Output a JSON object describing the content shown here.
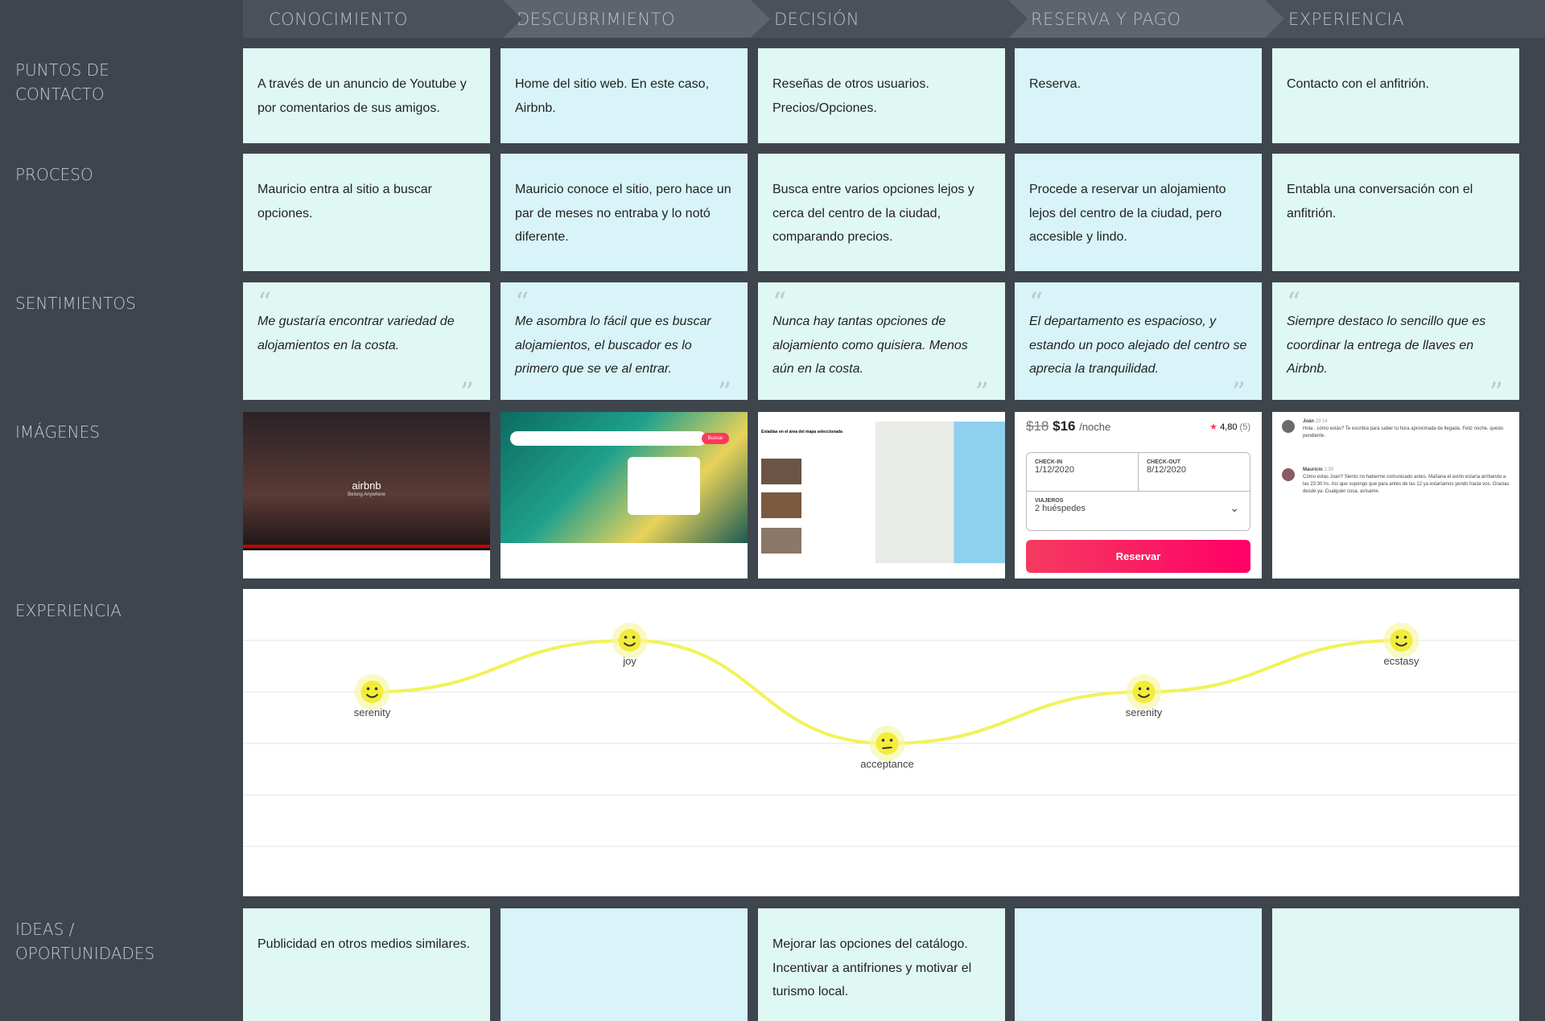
{
  "stages": [
    "CONOCIMIENTO",
    "DESCUBRIMIENTO",
    "DECISIÓN",
    "RESERVA Y PAGO",
    "EXPERIENCIA"
  ],
  "row_labels": {
    "touchpoints": "PUNTOS DE CONTACTO",
    "process": "PROCESO",
    "feelings": "SENTIMIENTOS",
    "images": "IMÁGENES",
    "experience": "EXPERIENCIA",
    "ideas": "IDEAS / OPORTUNIDADES"
  },
  "touchpoints": [
    "A través de un anuncio de Youtube y por comentarios de sus amigos.",
    "Home del sitio web. En este caso, Airbnb.",
    "Reseñas de otros usuarios. Precios/Opciones.",
    "Reserva.",
    "Contacto con el anfitrión."
  ],
  "process": [
    "Mauricio entra al sitio a buscar opciones.",
    "Mauricio conoce el sitio, pero hace un par de meses no entraba y lo notó diferente.",
    "Busca entre varios opciones lejos y cerca del centro de la ciudad, comparando precios.",
    "Procede a reservar un alojamiento lejos del centro de la ciudad, pero accesible y lindo.",
    "Entabla una conversación con el anfitrión."
  ],
  "feelings": [
    "Me gustaría encontrar variedad de alojamientos en la costa.",
    "Me asombra lo fácil que es buscar alojamientos, el buscador es lo primero que se ve al entrar.",
    "Nunca hay tantas opciones de alojamiento como quisiera. Menos aún en la costa.",
    "El departamento es espacioso, y estando un poco alejado del centro se aprecia la tranquilidad.",
    "Siempre destaco lo sencillo que es coordinar la entrega de llaves en Airbnb."
  ],
  "images": {
    "youtube": {
      "logo": "airbnb",
      "tagline": "Belong Anywhere"
    },
    "home": {
      "button": "Buscar"
    },
    "listing": {
      "title": "Estadías en el área del mapa seleccionada"
    },
    "booking": {
      "old_price": "$18",
      "price": "$16",
      "unit": "/noche",
      "rating": "4,80",
      "reviews": "(5)",
      "checkin_label": "CHECK-IN",
      "checkin": "1/12/2020",
      "checkout_label": "CHECK-OUT",
      "checkout": "8/12/2020",
      "guests_label": "VIAJEROS",
      "guests": "2 huéspedes",
      "button": "Reservar",
      "accent": "#ff385c"
    },
    "chat": [
      {
        "name": "Joán",
        "time": "23:14",
        "text": "Hola , cómo estás? Te escribía para saber tu hora aproximada de llegada. Feliz noche, quedo pendiente."
      },
      {
        "name": "Mauricio",
        "time": "1:39",
        "text": "Cómo estas Joan? Siento no haberme comunicado antes. Mañana el avión estaría arribando a las 23:30 hs. Así que supongo que para antes de las 12 ya estaríamos yendo hacia vos. Gracias desde ya. Cualquier cosa, avísame."
      }
    ]
  },
  "chart_data": {
    "type": "line",
    "categories": [
      "CONOCIMIENTO",
      "DESCUBRIMIENTO",
      "DECISIÓN",
      "RESERVA Y PAGO",
      "EXPERIENCIA"
    ],
    "emotions": [
      "serenity",
      "joy",
      "acceptance",
      "serenity",
      "ecstasy"
    ],
    "values": [
      4,
      5,
      3,
      4,
      5
    ],
    "ylim": [
      0,
      6
    ],
    "grid": true,
    "line_color": "#f2f25a"
  },
  "ideas": [
    "Publicidad en otros medios similares.",
    "",
    "Mejorar las opciones del catálogo. Incentivar a antifriones y motivar el turismo local.",
    "",
    ""
  ]
}
